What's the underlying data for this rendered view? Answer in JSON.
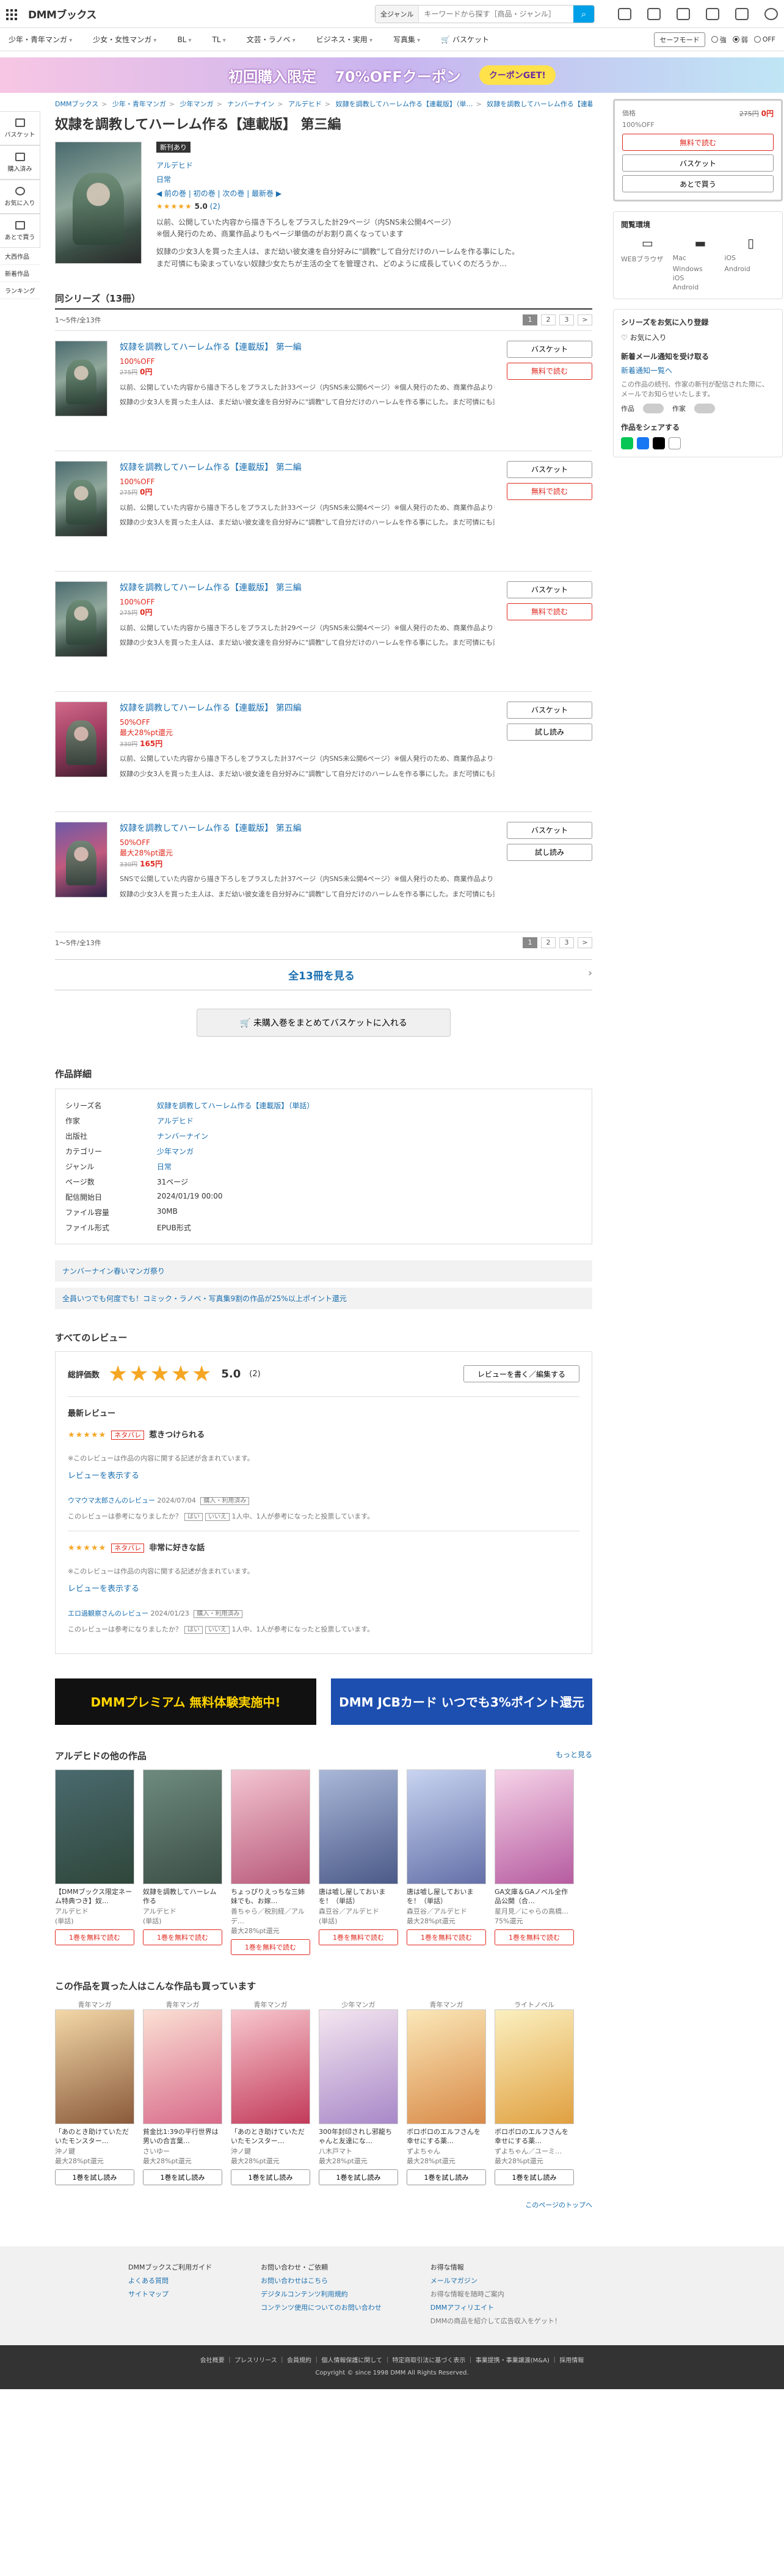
{
  "header": {
    "logo": "DMMブックス",
    "search_scope": "全ジャンル",
    "search_placeholder": "キーワードから探す［商品・ジャンル］"
  },
  "categories": [
    "少年・青年マンガ",
    "少女・女性マンガ",
    "BL",
    "TL",
    "文芸・ラノベ",
    "ビジネス・実用",
    "写真集"
  ],
  "catbar": {
    "basket": "バスケット",
    "safe": "セーフモード",
    "opt1": "強",
    "opt2": "弱",
    "opt3": "OFF"
  },
  "banner": {
    "main": "初回購入限定",
    "sub": "70%OFFクーポン",
    "pill": "クーポンGET!"
  },
  "rail": [
    "バスケット",
    "購入済み",
    "お気に入り",
    "あとで買う"
  ],
  "rail_text": [
    "大西作品",
    "新着作品",
    "ランキング"
  ],
  "breadcrumbs": [
    "DMMブックス",
    "少年・青年マンガ",
    "少年マンガ",
    "ナンバーナイン",
    "アルデヒド",
    "奴隷を調教してハーレム作る【連載版】（単…",
    "奴隷を調教してハーレム作る【連載版】 第三…"
  ],
  "product": {
    "title": "奴隷を調教してハーレム作る【連載版】 第三編",
    "badge": "新刊あり",
    "author": "アルデヒド",
    "genre": "日常",
    "nav": "◀ 前の巻 | 初の巻 | 次の巻 | 最新巻 ▶",
    "rating": "5.0",
    "rating_count": "(2)",
    "desc1": "以前、公開していた内容から描き下ろしをプラスした計29ページ（内SNS未公開4ページ）",
    "desc2": "※個人発行のため、商業作品よりもページ単価のがお割り高くなっています",
    "desc3": "奴隷の少女3人を買った主人は、まだ幼い彼女達を自分好みに\"調教\"して自分だけのハーレムを作る事にした。",
    "desc4": "まだ可憐にも染まっていない奴隷少女たちが主活の全てを管理され、どのように成長していくのだろうか…"
  },
  "series": {
    "header": "同シリーズ（13冊）",
    "count": "1〜5件/全13件",
    "pages": [
      "1",
      "2",
      "3",
      ">"
    ],
    "volumes": [
      {
        "title": "奴隷を調教してハーレム作る【連載版】 第一編",
        "off": "100%OFF",
        "price": "0円",
        "orig": "275円",
        "desc": "以前、公開していた内容から描き下ろしをプラスした計33ページ（内SNS未公開6ページ）※個人発行のため、商業作品よりもページ単価のがお割り高くなっています",
        "desc2": "奴隷の少女3人を買った主人は、まだ幼い彼女達を自分好みに\"調教\"して自分だけのハーレムを作る事にした。まだ可憐にも染まっていない奴隷少女たちが主活の全てを管理され、どのように成長していくのだろうか…",
        "basket": "バスケット",
        "action": "無料で読む",
        "kind": "free"
      },
      {
        "title": "奴隷を調教してハーレム作る【連載版】 第二編",
        "off": "100%OFF",
        "price": "0円",
        "orig": "275円",
        "desc": "以前、公開していた内容から描き下ろしをプラスした計33ページ（内SNS未公開4ページ）※個人発行のため、商業作品よりもページ単価のがお割り高くなっています",
        "desc2": "奴隷の少女3人を買った主人は、まだ幼い彼女達を自分好みに\"調教\"して自分だけのハーレムを作る事にした。まだ可憐にも染まっていない奴隷少女たちが主活の全てを管理され、どのように成長していくのだろうか…",
        "basket": "バスケット",
        "action": "無料で読む",
        "kind": "free"
      },
      {
        "title": "奴隷を調教してハーレム作る【連載版】 第三編",
        "off": "100%OFF",
        "price": "0円",
        "orig": "275円",
        "desc": "以前、公開していた内容から描き下ろしをプラスした計29ページ（内SNS未公開4ページ）※個人発行のため、商業作品よりもページ単価のがお割り高くなっています",
        "desc2": "奴隷の少女3人を買った主人は、まだ幼い彼女達を自分好みに\"調教\"して自分だけのハーレムを作る事にした。まだ可憐にも染まっていない奴隷少女たちが主活の全てを管理され、どのように成長していくのだろうか…",
        "basket": "バスケット",
        "action": "無料で読む",
        "kind": "free"
      },
      {
        "title": "奴隷を調教してハーレム作る【連載版】 第四編",
        "off": "50%OFF",
        "price": "165円",
        "orig": "330円",
        "points": "最大28%pt還元",
        "desc": "以前、公開していた内容から描き下ろしをプラスした計37ページ（内SNS未公開6ページ）※個人発行のため、商業作品よりもページ単価のがお割り高くなっています",
        "desc2": "奴隷の少女3人を買った主人は、まだ幼い彼女達を自分好みに\"調教\"して自分だけのハーレムを作る事にした。まだ可憐にも染まっていない奴隷少女たちが主活の全てを管理され、どのように成長していくのだろうか…",
        "basket": "バスケット",
        "action": "試し読み",
        "kind": "paid"
      },
      {
        "title": "奴隷を調教してハーレム作る【連載版】 第五編",
        "off": "50%OFF",
        "price": "165円",
        "orig": "330円",
        "points": "最大28%pt還元",
        "desc": "SNSで公開していた内容から描き下ろしをプラスした計37ページ（内SNS未公開4ページ）※個人発行のため、商業作品よりもページ単価のがお割り高くなっています",
        "desc2": "奴隷の少女3人を買った主人は、まだ幼い彼女達を自分好みに\"調教\"して自分だけのハーレムを作る事にした。まだ可憐にも染まっていない奴隷少女たちが主活の全てを管理され、どのように成長していくのだろうか…",
        "basket": "バスケット",
        "action": "試し読み",
        "kind": "paid"
      }
    ],
    "see_all": "全13冊を見る",
    "bulk": "未購入巻をまとめてバスケットに入れる"
  },
  "details": {
    "heading": "作品詳細",
    "rows": [
      [
        "シリーズ名",
        "奴隷を調教してハーレム作る【連載版】（単話）"
      ],
      [
        "作家",
        "アルデヒド"
      ],
      [
        "出版社",
        "ナンバーナイン"
      ],
      [
        "カテゴリー",
        "少年マンガ"
      ],
      [
        "ジャンル",
        "日常"
      ],
      [
        "ページ数",
        "31ページ"
      ],
      [
        "配信開始日",
        "2024/01/19 00:00"
      ],
      [
        "ファイル容量",
        "30MB"
      ],
      [
        "ファイル形式",
        "EPUB形式"
      ]
    ],
    "promo1": "ナンバーナイン春いマンガ祭り",
    "promo2": "全員いつでも何度でも！コミック・ラノベ・写真集9割の作品が25%以上ポイント還元"
  },
  "reviews": {
    "heading": "すべてのレビュー",
    "total_label": "総評価数",
    "score": "5.0",
    "count": "(2)",
    "write": "レビューを書く／編集する",
    "latest": "最新レビュー",
    "items": [
      {
        "tag": "ネタバレ",
        "title": "惹きつけられる",
        "note": "※このレビューは作品の内容に関する記述が含まれています。",
        "show": "レビューを表示する",
        "user": "ウマウマ太郎さんのレビュー",
        "date": "2024/07/04",
        "status": "購入・利用済み",
        "helpful": "このレビューは参考になりましたか？",
        "yes": "はい",
        "no": "いいえ",
        "votes": "1人中、1人が参考になったと投票しています。"
      },
      {
        "tag": "ネタバレ",
        "title": "非常に好きな話",
        "note": "※このレビューは作品の内容に関する記述が含まれています。",
        "show": "レビューを表示する",
        "user": "エロ過観察さんのレビュー",
        "date": "2024/01/23",
        "status": "購入・利用済み",
        "helpful": "このレビューは参考になりましたか？",
        "yes": "はい",
        "no": "いいえ",
        "votes": "1人中、1人が参考になったと投票しています。"
      }
    ]
  },
  "promos": {
    "b1": "DMMプレミアム 無料体験実施中!",
    "b2": "DMM JCBカード いつでも3%ポイント還元"
  },
  "author_works": {
    "heading": "アルデヒドの他の作品",
    "more": "もっと見る",
    "cards": [
      {
        "title": "【DMMブックス限定ネーム特典つき】奴…",
        "author": "アルデヒド",
        "tag": "(単話)",
        "btn": "1巻を無料で読む"
      },
      {
        "title": "奴隷を調教してハーレム作る",
        "author": "アルデヒド",
        "tag": "(単話)",
        "btn": "1巻を無料で読む"
      },
      {
        "title": "ちょっぴりえっちな三姉妹でも、お嫁…",
        "author": "善ちゃら／税別経／アルデ…",
        "tag": "最大28%pt還元",
        "btn": "1巻を無料で読む"
      },
      {
        "title": "唐は嘘し屋しておいまを！（単話）",
        "author": "森豆谷／アルデヒド",
        "tag": "(単話)",
        "btn": "1巻を無料で読む"
      },
      {
        "title": "唐は嘘し屋しておいまを！（単話）",
        "author": "森豆谷／アルデヒド",
        "tag": "最大28%pt還元",
        "btn": "1巻を無料で読む"
      },
      {
        "title": "GA文庫＆GAノベル全作品公開（合…",
        "author": "星月見／にゃらの高橋…",
        "tag": "75%還元",
        "btn": "1巻を無料で読む"
      }
    ]
  },
  "also_bought": {
    "heading": "この作品を買った人はこんな作品も買っています",
    "cards": [
      {
        "cat": "青年マンガ",
        "title": "「あのとき助けていただいたモンスター…",
        "author": "沖ノ鍵",
        "tag": "最大28%pt還元",
        "btn": "1巻を試し読み"
      },
      {
        "cat": "青年マンガ",
        "title": "貧金比1:39の平行世界は男いの合言葉…",
        "author": "さいゆー",
        "tag": "最大28%pt還元",
        "btn": "1巻を試し読み"
      },
      {
        "cat": "青年マンガ",
        "title": "「あのとき助けていただいたモンスター…",
        "author": "沖ノ鍵",
        "tag": "最大28%pt還元",
        "btn": "1巻を試し読み"
      },
      {
        "cat": "少年マンガ",
        "title": "300年封印されし邪龍ちゃんと友達にな…",
        "author": "八木戸マト",
        "tag": "最大28%pt還元",
        "btn": "1巻を試し読み"
      },
      {
        "cat": "青年マンガ",
        "title": "ボロボロのエルフさんを幸せにする薬…",
        "author": "ずよちゃん",
        "tag": "最大28%pt還元",
        "btn": "1巻を試し読み"
      },
      {
        "cat": "ライトノベル",
        "title": "ボロボロのエルフさんを幸せにする薬…",
        "author": "ずよちゃん／ユーミ…",
        "tag": "最大28%pt還元",
        "btn": "1巻を試し読み"
      }
    ]
  },
  "aside": {
    "price_label": "価格",
    "price_orig": "275円",
    "price": "0円",
    "off": "100%OFF",
    "read": "無料で読む",
    "basket": "バスケット",
    "later": "あとで買う",
    "env": "閲覧環境",
    "env_items": [
      "WEBブラウザ",
      "Mac",
      "iOS",
      "Windows",
      "Android",
      "iOS",
      "Android"
    ],
    "fav_head": "シリーズをお気に入り登録",
    "fav": "お気に入り",
    "new_head": "新着メール通知を受け取る",
    "new_link": "新着通知一覧へ",
    "new_desc": "この作品の続刊、作家の新刊が配信された際に、メールでお知らせいたします。",
    "t1": "作品",
    "t2": "作家",
    "share": "作品をシェアする"
  },
  "to_top": "このページのトップへ",
  "footer": {
    "col1": [
      "DMMブックスご利用ガイド",
      "よくある質問",
      "サイトマップ"
    ],
    "col2": [
      "お問い合わせ・ご依頼",
      "お問い合わせはこちら",
      "デジタルコンテンツ利用規約",
      "コンテンツ使用についてのお問い合わせ"
    ],
    "col3": [
      "お得な情報",
      "メールマガジン",
      "お得な情報を随時ご案内",
      "DMMアフィリエイト",
      "DMMの商品を紹介して広告収入をゲット！"
    ],
    "links": "会社概要 ｜ プレスリリース ｜ 会員規約 ｜ 個人情報保護に関して ｜ 特定商取引法に基づく表示 ｜ 事業提携・事業譲渡(M&A) ｜ 採用情報",
    "copy": "Copyright © since 1998 DMM All Rights Reserved."
  }
}
